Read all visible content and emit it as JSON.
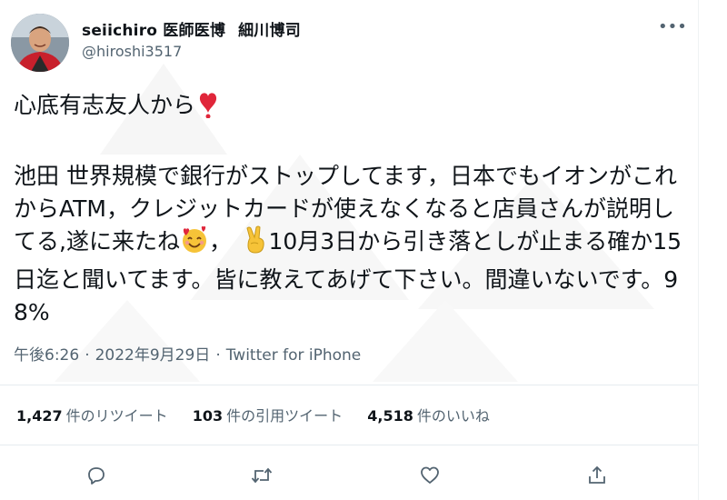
{
  "author": {
    "display_name_a": "seiichiro 医師医博",
    "display_name_b": "細川博司",
    "handle": "@hiroshi3517"
  },
  "tweet": {
    "line1": "心底有志友人から",
    "part_a": "池田 世界規模で銀行がストップしてます，日本でもイオンがこれからATM，クレジットカードが使えなくなると店員さんが説明してる,遂に来たね",
    "part_b": "，",
    "part_c": "10月3日から引き落としが止まる確か15日迄と聞いてます。皆に教えてあげて下さい。間違いないです。98%"
  },
  "meta": {
    "time": "午後6:26",
    "date": "2022年9月29日",
    "source": "Twitter for iPhone",
    "separator": "·"
  },
  "stats": {
    "retweets_num": "1,427",
    "retweets_label": "件のリツイート",
    "quotes_num": "103",
    "quotes_label": "件の引用ツイート",
    "likes_num": "4,518",
    "likes_label": "件のいいね"
  },
  "icons": {
    "more": "more-icon",
    "reply": "reply-icon",
    "retweet": "retweet-icon",
    "like": "like-icon",
    "share": "share-icon",
    "heart_exclamation": "heavy-heart-exclamation-emoji",
    "smiling_hearts": "smiling-face-with-hearts-emoji",
    "victory_hand": "victory-hand-emoji"
  },
  "colors": {
    "text": "#0f1419",
    "secondary": "#536471",
    "divider": "#e6ecf0",
    "emoji_red": "#e0263a"
  },
  "more_glyph": "•••"
}
